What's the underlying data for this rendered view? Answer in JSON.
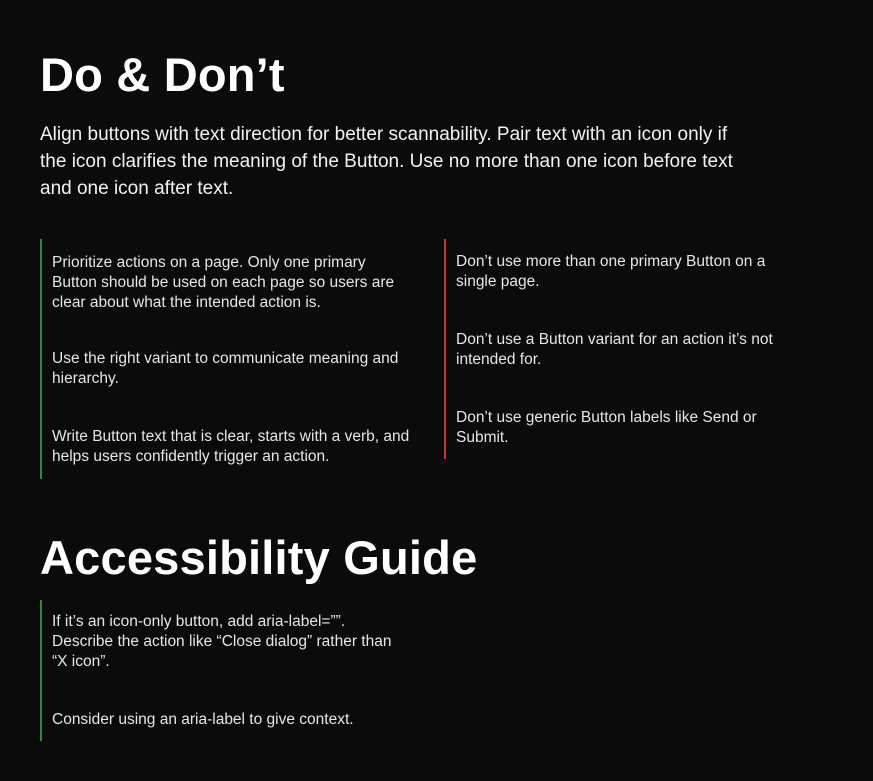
{
  "do_dont": {
    "title": "Do & Don’t",
    "intro": "Align buttons with text direction for better scannability. Pair text with an icon only if the icon clarifies the meaning of the Button. Use no more than one icon before text and one icon after text.",
    "do_items": [
      "Prioritize actions on a page. Only one primary Button should be used on each page so users are clear about what the intended action is.",
      "Use the right variant to communicate meaning and hierarchy.",
      "Write Button text that is clear, starts with a verb, and helps users confidently trigger an action."
    ],
    "dont_items": [
      "Don’t use more than one primary Button on a single page.",
      "Don’t use a Button variant for an action it’s not intended for.",
      "Don’t use generic Button labels like Send or Submit."
    ]
  },
  "accessibility": {
    "title": "Accessibility Guide",
    "items": [
      "If it’s an icon-only button, add aria-label=””. Describe the action like “Close dialog” rather than “X icon”.",
      "Consider using an aria-label to give context."
    ]
  },
  "colors": {
    "background": "#0b0b0b",
    "do_accent": "#2e8b3e",
    "dont_accent": "#c63a2e",
    "text": "#ffffff"
  }
}
